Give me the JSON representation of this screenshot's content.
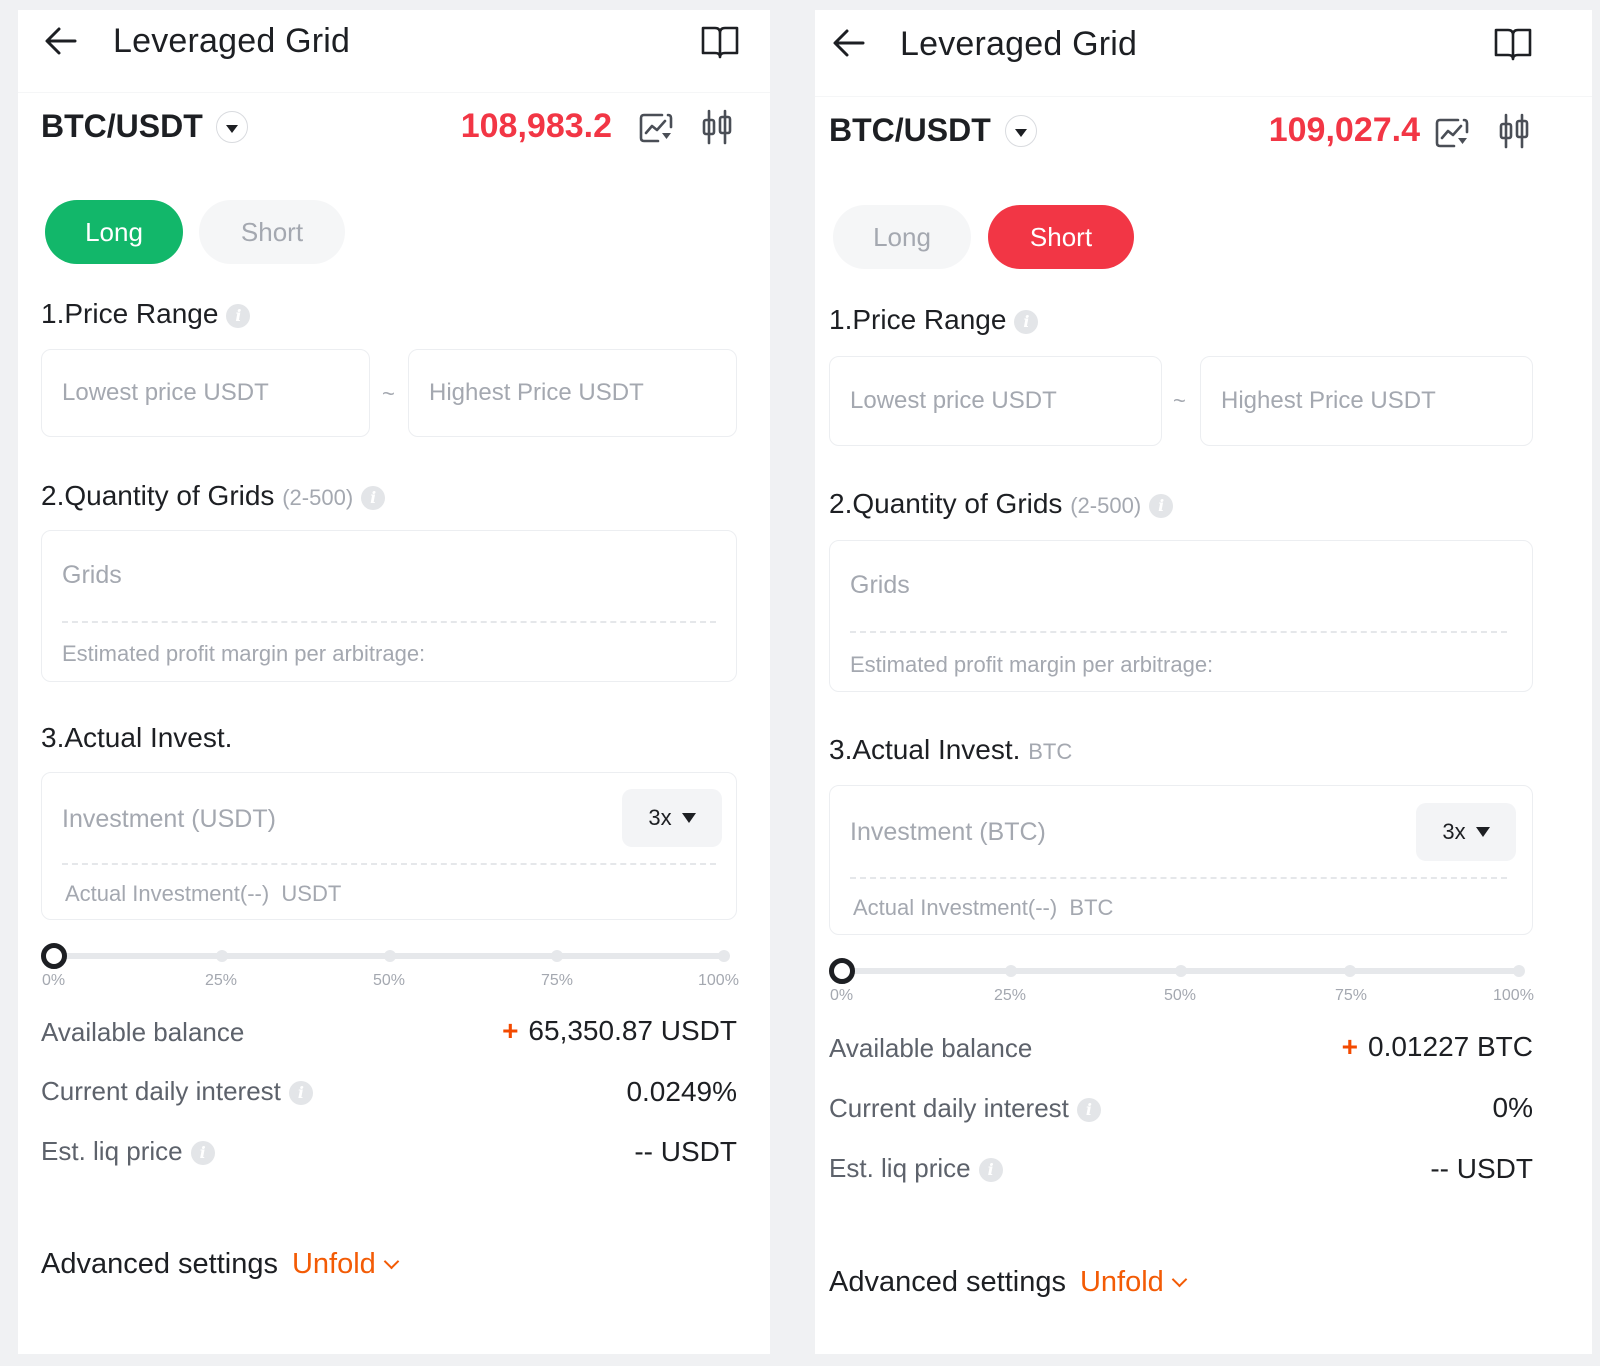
{
  "left": {
    "title": "Leveraged Grid",
    "pair": "BTC/USDT",
    "price": "108,983.2",
    "tabs": {
      "long": "Long",
      "short": "Short",
      "active": "long"
    },
    "price_range": {
      "label": "1.Price Range",
      "lowest_placeholder": "Lowest price USDT",
      "separator": "~",
      "highest_placeholder": "Highest Price USDT"
    },
    "grids": {
      "label": "2.Quantity of Grids",
      "range": "(2-500)",
      "placeholder": "Grids",
      "profit_label": "Estimated profit margin per arbitrage:"
    },
    "invest": {
      "label": "3.Actual Invest.",
      "unit": "",
      "placeholder": "Investment (USDT)",
      "leverage": "3x",
      "actual_label": "Actual Investment(--)",
      "actual_unit": "USDT"
    },
    "slider": {
      "value_pct": 0,
      "ticks": [
        "0%",
        "25%",
        "50%",
        "75%",
        "100%"
      ]
    },
    "balance": {
      "label": "Available balance",
      "value": "65,350.87 USDT"
    },
    "interest": {
      "label": "Current daily interest",
      "value": "0.0249%"
    },
    "liq": {
      "label": "Est. liq price",
      "value": "-- USDT"
    },
    "advanced": {
      "label": "Advanced settings",
      "unfold": "Unfold"
    }
  },
  "right": {
    "title": "Leveraged Grid",
    "pair": "BTC/USDT",
    "price": "109,027.4",
    "tabs": {
      "long": "Long",
      "short": "Short",
      "active": "short"
    },
    "price_range": {
      "label": "1.Price Range",
      "lowest_placeholder": "Lowest price USDT",
      "separator": "~",
      "highest_placeholder": "Highest Price USDT"
    },
    "grids": {
      "label": "2.Quantity of Grids",
      "range": "(2-500)",
      "placeholder": "Grids",
      "profit_label": "Estimated profit margin per arbitrage:"
    },
    "invest": {
      "label": "3.Actual Invest.",
      "unit": "BTC",
      "placeholder": "Investment (BTC)",
      "leverage": "3x",
      "actual_label": "Actual Investment(--)",
      "actual_unit": "BTC"
    },
    "slider": {
      "value_pct": 0,
      "ticks": [
        "0%",
        "25%",
        "50%",
        "75%",
        "100%"
      ]
    },
    "balance": {
      "label": "Available balance",
      "value": "0.01227 BTC"
    },
    "interest": {
      "label": "Current daily interest",
      "value": "0%"
    },
    "liq": {
      "label": "Est. liq price",
      "value": "-- USDT"
    },
    "advanced": {
      "label": "Advanced settings",
      "unfold": "Unfold"
    }
  },
  "colors": {
    "long_active": "#12b76a",
    "short_active": "#f23645",
    "price": "#f23645",
    "unfold": "#f35b05"
  }
}
